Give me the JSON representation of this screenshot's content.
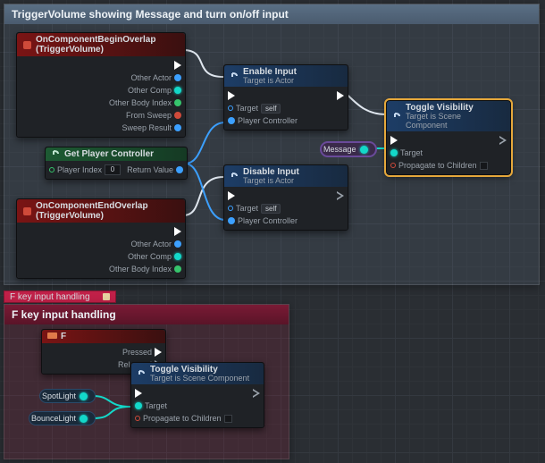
{
  "comment1": {
    "title": "TriggerVolume showing Message and turn on/off input"
  },
  "tab": {
    "label": "F key input handling"
  },
  "comment2": {
    "title": "F key input handling"
  },
  "targetSub": "Target is Actor",
  "targetSubComp": "Target is Scene Component",
  "pins": {
    "otherActor": "Other Actor",
    "otherComp": "Other Comp",
    "otherBodyIdx": "Other Body Index",
    "fromSweep": "From Sweep",
    "sweepResult": "Sweep Result",
    "target": "Target",
    "self": "self",
    "playerController": "Player Controller",
    "playerIndex": "Player Index",
    "returnValue": "Return Value",
    "propagate": "Propagate to Children",
    "pressed": "Pressed",
    "released": "Released",
    "zero": "0"
  },
  "nodes": {
    "beginOverlap": "OnComponentBeginOverlap (TriggerVolume)",
    "endOverlap": "OnComponentEndOverlap (TriggerVolume)",
    "getPC": "Get Player Controller",
    "enable": "Enable Input",
    "disable": "Disable Input",
    "toggleVis": "Toggle Visibility",
    "fkey": "F"
  },
  "pills": {
    "message": "Message",
    "spotlight": "SpotLight",
    "bouncelight": "BounceLight"
  }
}
